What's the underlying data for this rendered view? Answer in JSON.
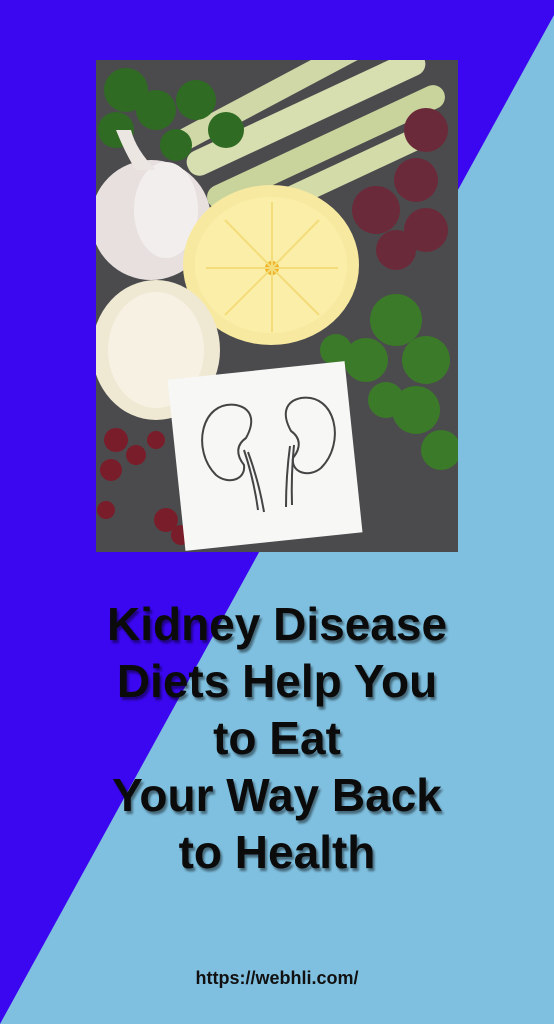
{
  "colors": {
    "blue": "#3a07f0",
    "light_blue": "#7fc0e0"
  },
  "photo": {
    "subject": "kidney-healthy-foods-photo"
  },
  "title": {
    "lines": [
      "Kidney Disease",
      "Diets Help You",
      "to Eat",
      "Your Way Back",
      "to Health"
    ]
  },
  "footer": {
    "url": "https://webhli.com/"
  }
}
